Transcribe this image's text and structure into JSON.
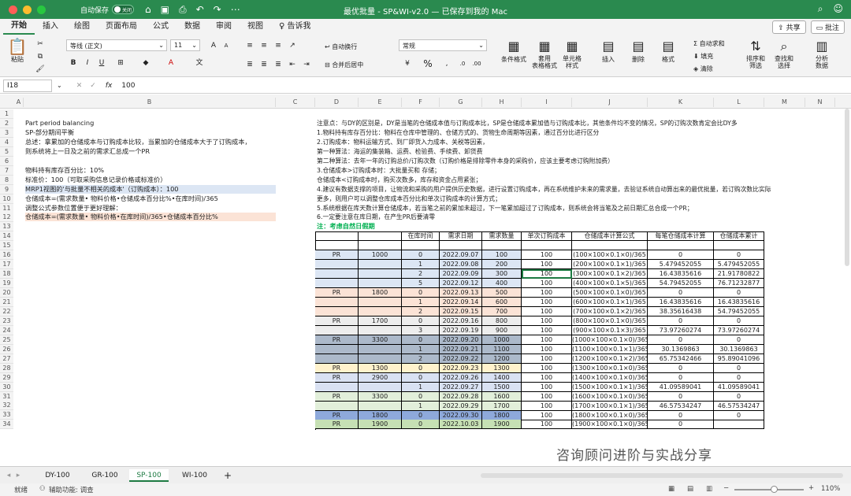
{
  "window": {
    "autosave": "自动保存",
    "autosave_state": "关闭",
    "title": "最优批量 - SP&WI-v2.0 — 已保存到我的 Mac"
  },
  "menu": {
    "tabs": [
      "开始",
      "插入",
      "绘图",
      "页面布局",
      "公式",
      "数据",
      "审阅",
      "视图",
      "告诉我"
    ],
    "share": "共享",
    "comment": "批注"
  },
  "ribbon": {
    "paste": "粘贴",
    "font_name": "等线 (正文)",
    "font_size": "11",
    "wrap": "自动换行",
    "merge": "合并后居中",
    "number_format": "常规",
    "cond_format": "条件格式",
    "table_format": "套用\n表格格式",
    "cell_style": "单元格\n样式",
    "insert": "插入",
    "delete": "删除",
    "format": "格式",
    "autosum": "自动求和",
    "fill": "填充",
    "clear": "清除",
    "sort": "排序和\n筛选",
    "find": "查找和\n选择",
    "analyze": "分析\n数据"
  },
  "formula_bar": {
    "name_box": "I18",
    "fx": "fx",
    "value": "100"
  },
  "columns": [
    "A",
    "B",
    "C",
    "D",
    "E",
    "F",
    "G",
    "H",
    "I",
    "J",
    "K",
    "L",
    "M",
    "N"
  ],
  "rows": [
    "1",
    "2",
    "3",
    "4",
    "5",
    "6",
    "7",
    "8",
    "9",
    "10",
    "11",
    "12",
    "13",
    "14",
    "15",
    "16",
    "17",
    "18",
    "19",
    "20",
    "21",
    "22",
    "23",
    "24",
    "25",
    "26",
    "27",
    "28",
    "29",
    "30",
    "31",
    "32",
    "33",
    "34"
  ],
  "left_text": [
    "Part period balancing",
    "SP-部分期间平衡",
    "总述：拿累加的仓储成本与订购成本比较，当累加的仓储成本大于了订购成本，",
    "则系统将上一日及之前的需求汇总成一个PR",
    "物料持有库存百分比：10%",
    "标准价：100（可取采购信息记录价格或标准价）",
    "MRP1视图的'与批量不相关的成本'（订购成本）：100",
    "仓储成本=(需求数量• 物料价格•仓储成本百分比%•在库时间)/365",
    "调整公式参数位置便于更好理解：",
    "仓储成本=(需求数量• 物料价格•在库时间)/365•仓储成本百分比%"
  ],
  "notes": [
    "注意点：与DY的区别是，DY是当笔的仓储成本值与订购成本比，SP是仓储成本累加值与订购成本比，其他条件均不变的情况，SP的订购次数肯定会比DY多",
    "1.物料持有库存百分比：物料在仓库中管理的、仓储方式的、货物生命周期等因素，通过百分比进行区分",
    "2.订购成本：物料运输方式、到厂即货入力成本、关税等因素，",
    "第一种算法：海运的集装箱、运费、检验费、手续费、卸货费",
    "第二种算法：去年一年的订购总价/订购次数（订购价格是排除零件本身的采购价，应该主要考虑订购附加费）",
    "3.仓储成本>订购成本时：大批量买和 存储；",
    "仓储成本<订购成本时，购买次数多，库存和资金占用紧张；",
    "4.建议有数据支撑的项目，让物流和采购的用户提供历史数据，进行设置订购成本，再在系统维护未来的需求量，去验证系统自动算出来的最优批量，若订购次数比实际",
    "更多，则用户可以调整仓库成本百分比和单次订购成本的计算方式；",
    "5.系统根据在库天数计算仓储成本，若当笔之前的累加未超过，下一笔累加超过了订购成本，则系统会将当笔及之前日期汇总合成一个PR；",
    "6.一定要注意在库日期，在产生PR后要清零"
  ],
  "table_note": "注：考虑自然日假期",
  "table_headers": [
    "在库时间",
    "需求日期",
    "需求数量",
    "单次订购成本",
    "仓储成本计算公式",
    "每笔仓储成本计算",
    "仓储成本累计"
  ],
  "table_rows": [
    [
      "PR",
      "1000",
      "0",
      "2022.09.07",
      "100",
      "100",
      "(100×100×0.1×0)/365",
      "0",
      "0"
    ],
    [
      "",
      "",
      "1",
      "2022.09.08",
      "200",
      "100",
      "(200×100×0.1×1)/365",
      "5.479452055",
      "5.479452055"
    ],
    [
      "",
      "",
      "2",
      "2022.09.09",
      "300",
      "100",
      "(300×100×0.1×2)/365",
      "16.43835616",
      "21.91780822"
    ],
    [
      "",
      "",
      "5",
      "2022.09.12",
      "400",
      "100",
      "(400×100×0.1×5)/365",
      "54.79452055",
      "76.71232877"
    ],
    [
      "PR",
      "1800",
      "0",
      "2022.09.13",
      "500",
      "100",
      "(500×100×0.1×0)/365",
      "0",
      "0"
    ],
    [
      "",
      "",
      "1",
      "2022.09.14",
      "600",
      "100",
      "(600×100×0.1×1)/365",
      "16.43835616",
      "16.43835616"
    ],
    [
      "",
      "",
      "2",
      "2022.09.15",
      "700",
      "100",
      "(700×100×0.1×2)/365",
      "38.35616438",
      "54.79452055"
    ],
    [
      "PR",
      "1700",
      "0",
      "2022.09.16",
      "800",
      "100",
      "(800×100×0.1×0)/365",
      "0",
      "0"
    ],
    [
      "",
      "",
      "3",
      "2022.09.19",
      "900",
      "100",
      "(900×100×0.1×3)/365",
      "73.97260274",
      "73.97260274"
    ],
    [
      "PR",
      "3300",
      "0",
      "2022.09.20",
      "1000",
      "100",
      "(1000×100×0.1×0)/365",
      "0",
      "0"
    ],
    [
      "",
      "",
      "1",
      "2022.09.21",
      "1100",
      "100",
      "(1100×100×0.1×1)/365",
      "30.1369863",
      "30.1369863"
    ],
    [
      "",
      "",
      "2",
      "2022.09.22",
      "1200",
      "100",
      "(1200×100×0.1×2)/365",
      "65.75342466",
      "95.89041096"
    ],
    [
      "PR",
      "1300",
      "0",
      "2022.09.23",
      "1300",
      "100",
      "(1300×100×0.1×0)/365",
      "0",
      "0"
    ],
    [
      "PR",
      "2900",
      "0",
      "2022.09.26",
      "1400",
      "100",
      "(1400×100×0.1×0)/365",
      "0",
      "0"
    ],
    [
      "",
      "",
      "1",
      "2022.09.27",
      "1500",
      "100",
      "(1500×100×0.1×1)/365",
      "41.09589041",
      "41.09589041"
    ],
    [
      "PR",
      "3300",
      "0",
      "2022.09.28",
      "1600",
      "100",
      "(1600×100×0.1×0)/365",
      "0",
      "0"
    ],
    [
      "",
      "",
      "1",
      "2022.09.29",
      "1700",
      "100",
      "(1700×100×0.1×1)/365",
      "46.57534247",
      "46.57534247"
    ],
    [
      "PR",
      "1800",
      "0",
      "2022.09.30",
      "1800",
      "100",
      "(1800×100×0.1×0)/365",
      "0",
      "0"
    ],
    [
      "PR",
      "1900",
      "0",
      "2022.10.03",
      "1900",
      "100",
      "(1900×100×0.1×0)/365",
      "0",
      ""
    ]
  ],
  "colors": {
    "group1": "#dce6f4",
    "group2": "#fbe3d6",
    "group3": "#ededed",
    "group4": "#acb9ca",
    "group5": "#fff2cc",
    "group6": "#d9e1f2",
    "group7": "#e2efda",
    "group8": "#8ea9db",
    "group9": "#c6e0b4",
    "accent": "#2a8a4f",
    "note_green": "#00b050"
  },
  "sheets": [
    "DY-100",
    "GR-100",
    "SP-100",
    "WI-100",
    "+"
  ],
  "status": {
    "ready": "就绪",
    "accessibility": "辅助功能: 调查",
    "zoom": "110%"
  },
  "watermark": "咨询顾问进阶与实战分享"
}
